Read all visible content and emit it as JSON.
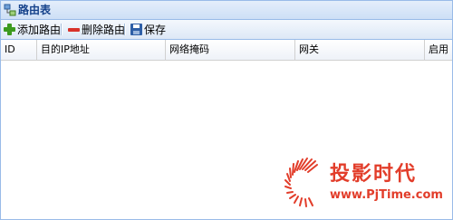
{
  "window": {
    "title": "路由表",
    "icon": "route-table-icon"
  },
  "toolbar": {
    "add_label": "添加路由",
    "delete_label": "删除路由",
    "save_label": "保存",
    "add_icon": "plus-icon",
    "delete_icon": "minus-icon",
    "save_icon": "floppy-disk-icon"
  },
  "grid": {
    "columns": [
      "ID",
      "目的IP地址",
      "网络掩码",
      "网关",
      "启用"
    ],
    "rows": []
  },
  "watermark": {
    "title": "投影时代",
    "url": "www.PjTime.com"
  },
  "colors": {
    "accent": "#15428b",
    "border": "#99bbe8",
    "watermark": "#e23d2a"
  }
}
